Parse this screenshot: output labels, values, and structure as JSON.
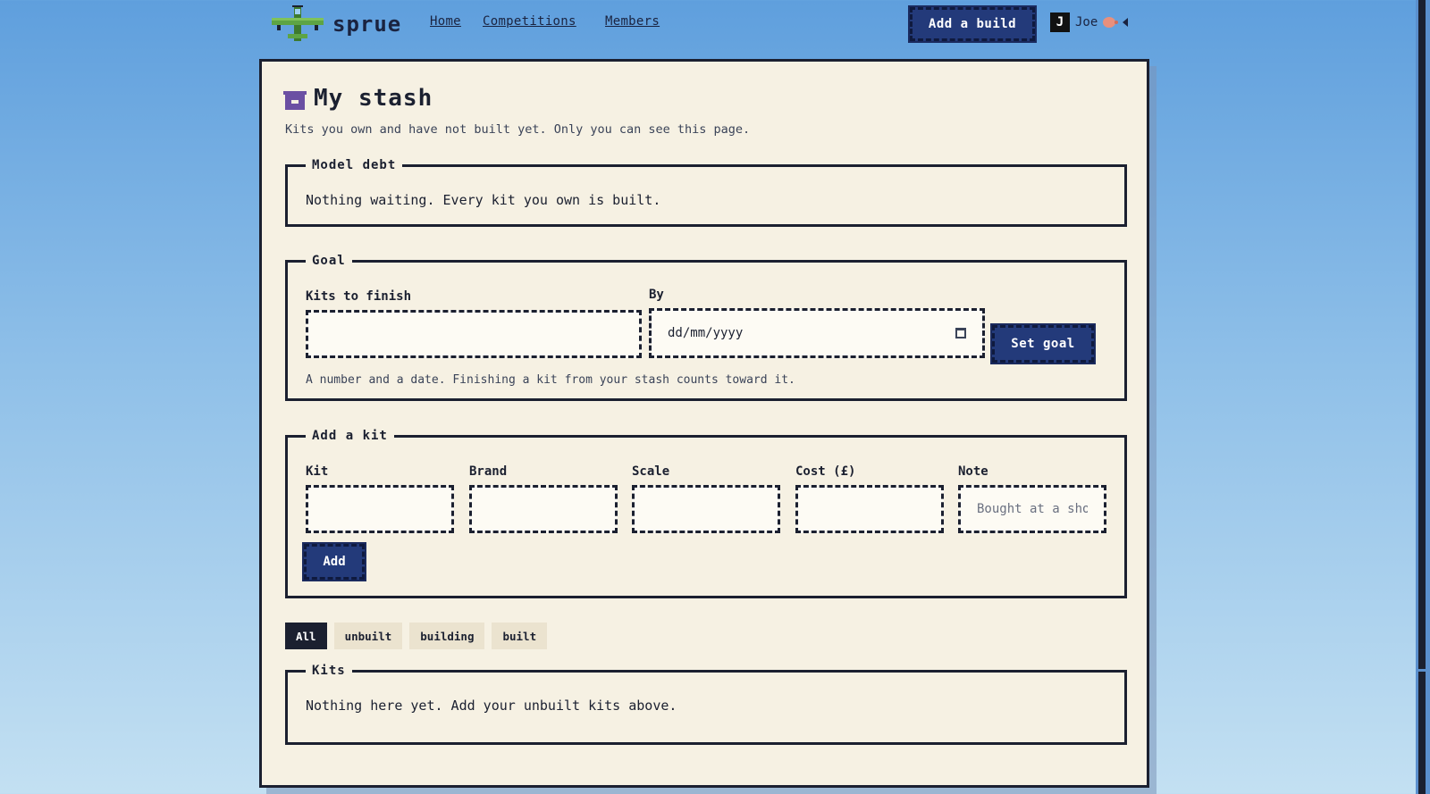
{
  "nav": {
    "brand": "sprue",
    "links": [
      {
        "label": "Home"
      },
      {
        "label": "Competitions"
      },
      {
        "label": "Members"
      }
    ],
    "add_build_label": "Add a build",
    "user": {
      "initial": "J",
      "name": "Joe"
    }
  },
  "page": {
    "title": "My stash",
    "subtitle": "Kits you own and have not built yet. Only you can see this page."
  },
  "model_debt": {
    "legend": "Model debt",
    "message": "Nothing waiting. Every kit you own is built."
  },
  "goal": {
    "legend": "Goal",
    "kits_label": "Kits to finish",
    "kits_value": "",
    "by_label": "By",
    "date_placeholder": "dd/mm/yyyy",
    "button_label": "Set goal",
    "hint": "A number and a date. Finishing a kit from your stash counts toward it."
  },
  "add_kit": {
    "legend": "Add a kit",
    "fields": [
      {
        "label": "Kit",
        "placeholder": ""
      },
      {
        "label": "Brand",
        "placeholder": ""
      },
      {
        "label": "Scale",
        "placeholder": ""
      },
      {
        "label": "Cost (£)",
        "placeholder": ""
      },
      {
        "label": "Note",
        "placeholder": "Bought at a sho"
      }
    ],
    "button_label": "Add"
  },
  "filters": [
    {
      "label": "All",
      "active": true
    },
    {
      "label": "unbuilt",
      "active": false
    },
    {
      "label": "building",
      "active": false
    },
    {
      "label": "built",
      "active": false
    }
  ],
  "kits": {
    "legend": "Kits",
    "message": "Nothing here yet. Add your unbuilt kits above."
  },
  "colors": {
    "accent": "#233a7a",
    "card_bg": "#f6f1e3",
    "ink": "#1b2030",
    "icon_purple": "#6b4fa3"
  }
}
